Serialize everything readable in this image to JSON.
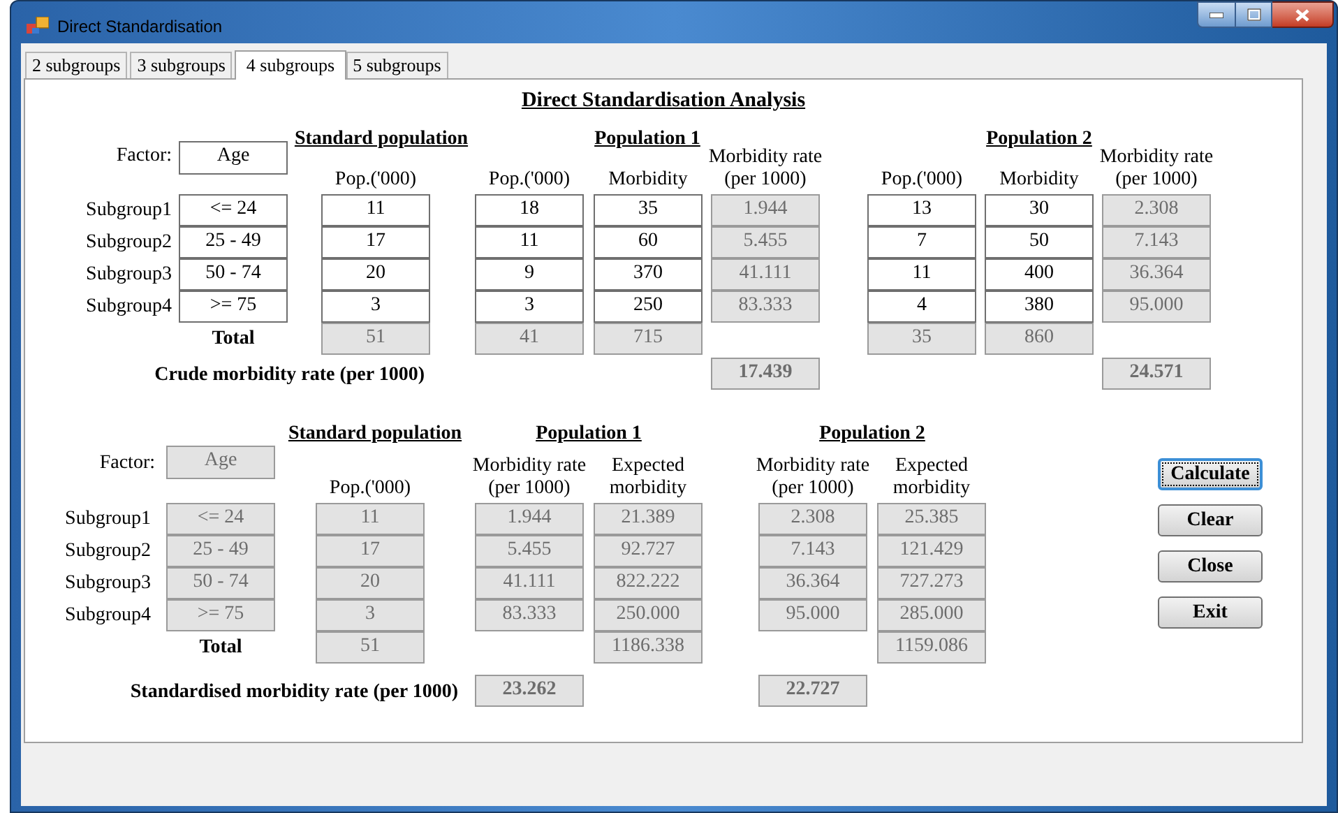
{
  "window": {
    "title": "Direct Standardisation"
  },
  "tabs": [
    {
      "label": "2 subgroups",
      "selected": false
    },
    {
      "label": "3 subgroups",
      "selected": false
    },
    {
      "label": "4 subgroups",
      "selected": true
    },
    {
      "label": "5 subgroups",
      "selected": false
    }
  ],
  "analysis_title": "Direct Standardisation Analysis",
  "crude": {
    "factor_label": "Factor:",
    "factor": {
      "value": "Age",
      "disabled": false
    },
    "group_headings": [
      "Standard population",
      "Population 1",
      "Population 2"
    ],
    "row_labels": [
      "Subgroup1",
      "Subgroup2",
      "Subgroup3",
      "Subgroup4"
    ],
    "total_label": "Total",
    "summary_label": "Crude morbidity rate (per 1000)",
    "columns": [
      {
        "cells": [
          {
            "value": "<= 24",
            "disabled": false
          },
          {
            "value": "25 - 49",
            "disabled": false
          },
          {
            "value": "50 - 74",
            "disabled": false
          },
          {
            "value": ">= 75",
            "disabled": false
          }
        ]
      },
      {
        "header": "Pop.('000)",
        "cells": [
          {
            "value": "11",
            "disabled": false
          },
          {
            "value": "17",
            "disabled": false
          },
          {
            "value": "20",
            "disabled": false
          },
          {
            "value": "3",
            "disabled": false
          }
        ],
        "total": {
          "value": "51",
          "disabled": true
        }
      },
      {
        "header": "Pop.('000)",
        "cells": [
          {
            "value": "18",
            "disabled": false
          },
          {
            "value": "11",
            "disabled": false
          },
          {
            "value": "9",
            "disabled": false
          },
          {
            "value": "3",
            "disabled": false
          }
        ],
        "total": {
          "value": "41",
          "disabled": true
        }
      },
      {
        "header": "Morbidity",
        "cells": [
          {
            "value": "35",
            "disabled": false
          },
          {
            "value": "60",
            "disabled": false
          },
          {
            "value": "370",
            "disabled": false
          },
          {
            "value": "250",
            "disabled": false
          }
        ],
        "total": {
          "value": "715",
          "disabled": true
        }
      },
      {
        "header": "Morbidity rate (per 1000)",
        "cells": [
          {
            "value": "1.944",
            "disabled": true
          },
          {
            "value": "5.455",
            "disabled": true
          },
          {
            "value": "41.111",
            "disabled": true
          },
          {
            "value": "83.333",
            "disabled": true
          }
        ],
        "summary": {
          "value": "17.439",
          "disabled": true
        }
      },
      {
        "header": "Pop.('000)",
        "cells": [
          {
            "value": "13",
            "disabled": false
          },
          {
            "value": "7",
            "disabled": false
          },
          {
            "value": "11",
            "disabled": false
          },
          {
            "value": "4",
            "disabled": false
          }
        ],
        "total": {
          "value": "35",
          "disabled": true
        }
      },
      {
        "header": "Morbidity",
        "cells": [
          {
            "value": "30",
            "disabled": false
          },
          {
            "value": "50",
            "disabled": false
          },
          {
            "value": "400",
            "disabled": false
          },
          {
            "value": "380",
            "disabled": false
          }
        ],
        "total": {
          "value": "860",
          "disabled": true
        }
      },
      {
        "header": "Morbidity rate (per 1000)",
        "cells": [
          {
            "value": "2.308",
            "disabled": true
          },
          {
            "value": "7.143",
            "disabled": true
          },
          {
            "value": "36.364",
            "disabled": true
          },
          {
            "value": "95.000",
            "disabled": true
          }
        ],
        "summary": {
          "value": "24.571",
          "disabled": true
        }
      }
    ]
  },
  "standardised": {
    "factor_label": "Factor:",
    "factor": {
      "value": "Age",
      "disabled": true
    },
    "group_headings": [
      "Standard population",
      "Population 1",
      "Population 2"
    ],
    "row_labels": [
      "Subgroup1",
      "Subgroup2",
      "Subgroup3",
      "Subgroup4"
    ],
    "total_label": "Total",
    "summary_label": "Standardised morbidity rate (per 1000)",
    "columns": [
      {
        "cells": [
          {
            "value": "<= 24",
            "disabled": true
          },
          {
            "value": "25 - 49",
            "disabled": true
          },
          {
            "value": "50 - 74",
            "disabled": true
          },
          {
            "value": ">= 75",
            "disabled": true
          }
        ]
      },
      {
        "header": "Pop.('000)",
        "cells": [
          {
            "value": "11",
            "disabled": true
          },
          {
            "value": "17",
            "disabled": true
          },
          {
            "value": "20",
            "disabled": true
          },
          {
            "value": "3",
            "disabled": true
          }
        ],
        "total": {
          "value": "51",
          "disabled": true
        }
      },
      {
        "header": "Morbidity rate (per 1000)",
        "cells": [
          {
            "value": "1.944",
            "disabled": true
          },
          {
            "value": "5.455",
            "disabled": true
          },
          {
            "value": "41.111",
            "disabled": true
          },
          {
            "value": "83.333",
            "disabled": true
          }
        ],
        "summary": {
          "value": "23.262",
          "disabled": true
        }
      },
      {
        "header": "Expected morbidity",
        "cells": [
          {
            "value": "21.389",
            "disabled": true
          },
          {
            "value": "92.727",
            "disabled": true
          },
          {
            "value": "822.222",
            "disabled": true
          },
          {
            "value": "250.000",
            "disabled": true
          }
        ],
        "total": {
          "value": "1186.338",
          "disabled": true
        }
      },
      {
        "header": "Morbidity rate (per 1000)",
        "cells": [
          {
            "value": "2.308",
            "disabled": true
          },
          {
            "value": "7.143",
            "disabled": true
          },
          {
            "value": "36.364",
            "disabled": true
          },
          {
            "value": "95.000",
            "disabled": true
          }
        ],
        "summary": {
          "value": "22.727",
          "disabled": true
        }
      },
      {
        "header": "Expected morbidity",
        "cells": [
          {
            "value": "25.385",
            "disabled": true
          },
          {
            "value": "121.429",
            "disabled": true
          },
          {
            "value": "727.273",
            "disabled": true
          },
          {
            "value": "285.000",
            "disabled": true
          }
        ],
        "total": {
          "value": "1159.086",
          "disabled": true
        }
      }
    ]
  },
  "buttons": [
    {
      "label": "Calculate",
      "focused": true
    },
    {
      "label": "Clear",
      "focused": false
    },
    {
      "label": "Close",
      "focused": false
    },
    {
      "label": "Exit",
      "focused": false
    }
  ]
}
